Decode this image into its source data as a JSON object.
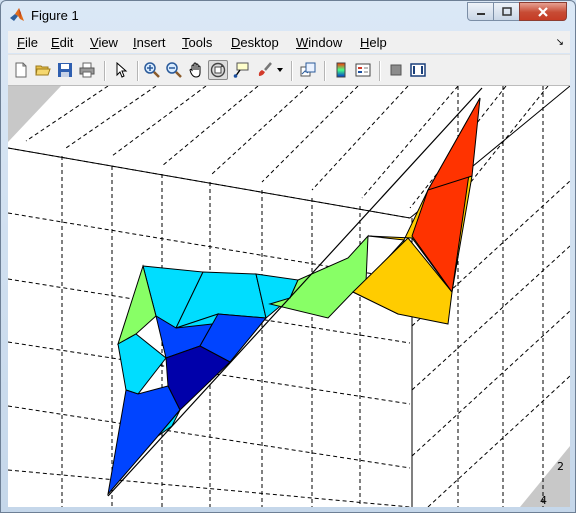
{
  "window": {
    "title": "Figure 1"
  },
  "menu": {
    "file": "File",
    "edit": "Edit",
    "view": "View",
    "insert": "Insert",
    "tools": "Tools",
    "desktop": "Desktop",
    "window": "Window",
    "help": "Help"
  },
  "toolbar": {
    "buttons": [
      "new-figure",
      "open-file",
      "save-figure",
      "print-figure",
      "edit-plot",
      "zoom-in",
      "zoom-out",
      "pan",
      "rotate-3d",
      "data-cursor",
      "brush",
      "brush-dropdown",
      "link-plot",
      "insert-colorbar",
      "insert-legend",
      "hide-plot-tools",
      "show-plot-tools"
    ],
    "active": "rotate-3d"
  },
  "axes": {
    "visible_tick_labels": [
      "2",
      "4"
    ],
    "grid": "dashed"
  },
  "chart_data": {
    "type": "surface",
    "colormap": "jet",
    "grid": true,
    "colors": [
      "#0000aa",
      "#0044ff",
      "#00ddff",
      "#88ff66",
      "#ffcc00",
      "#ff3300"
    ]
  }
}
